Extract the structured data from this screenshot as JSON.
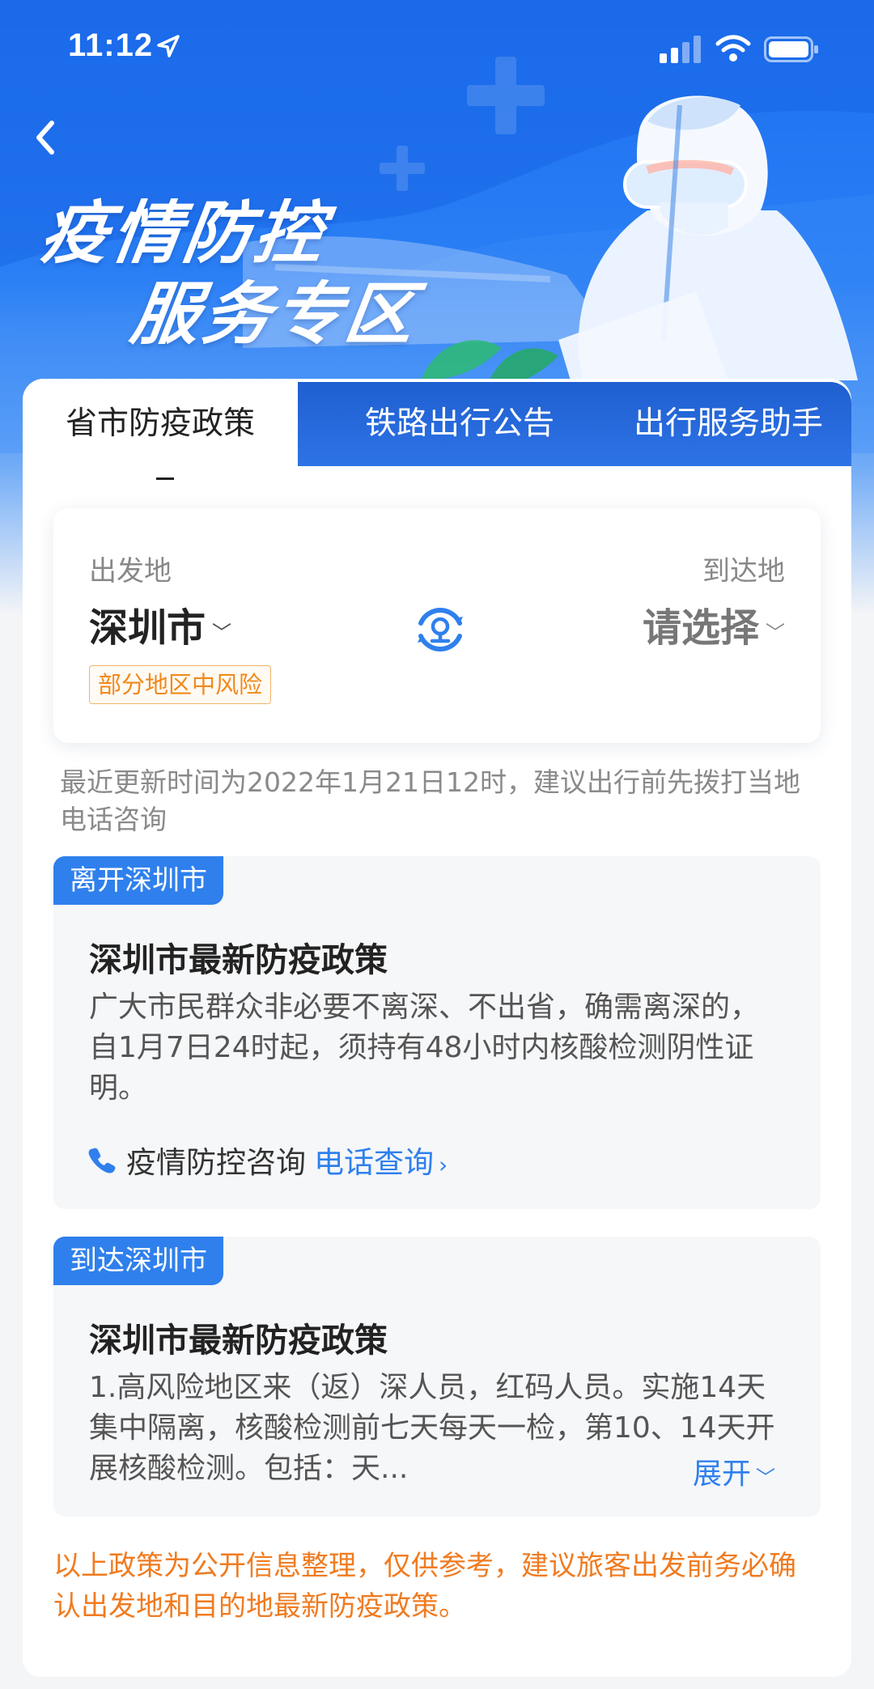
{
  "status_bar": {
    "time": "11:12"
  },
  "hero": {
    "title_line1": "疫情防控",
    "title_line2": "服务专区"
  },
  "tabs": [
    {
      "label": "省市防疫政策",
      "active": true
    },
    {
      "label": "铁路出行公告",
      "active": false
    },
    {
      "label": "出行服务助手",
      "active": false
    }
  ],
  "route": {
    "from_label": "出发地",
    "from_city": "深圳市",
    "from_risk": "部分地区中风险",
    "to_label": "到达地",
    "to_city": "请选择"
  },
  "update_note": "最近更新时间为2022年1月21日12时，建议出行前先拨打当地电话咨询",
  "leave_policy": {
    "tag": "离开深圳市",
    "title": "深圳市最新防疫政策",
    "body": "广大市民群众非必要不离深、不出省，确需离深的，自1月7日24时起，须持有48小时内核酸检测阴性证明。",
    "contact_label": "疫情防控咨询",
    "contact_link": "电话查询"
  },
  "arrive_policy": {
    "tag": "到达深圳市",
    "title": "深圳市最新防疫政策",
    "body": "1.高风险地区来（返）深人员，红码人员。实施14天集中隔离，核酸检测前七天每天一检，第10、14天开展核酸检测。包括：天...",
    "expand_label": "展开"
  },
  "disclaimer": "以上政策为公开信息整理，仅供参考，建议旅客出发前务必确认出发地和目的地最新防疫政策。",
  "colors": {
    "brand_blue": "#2f80ed",
    "warning_orange": "#f07b20",
    "risk_orange": "#f08a1c"
  }
}
